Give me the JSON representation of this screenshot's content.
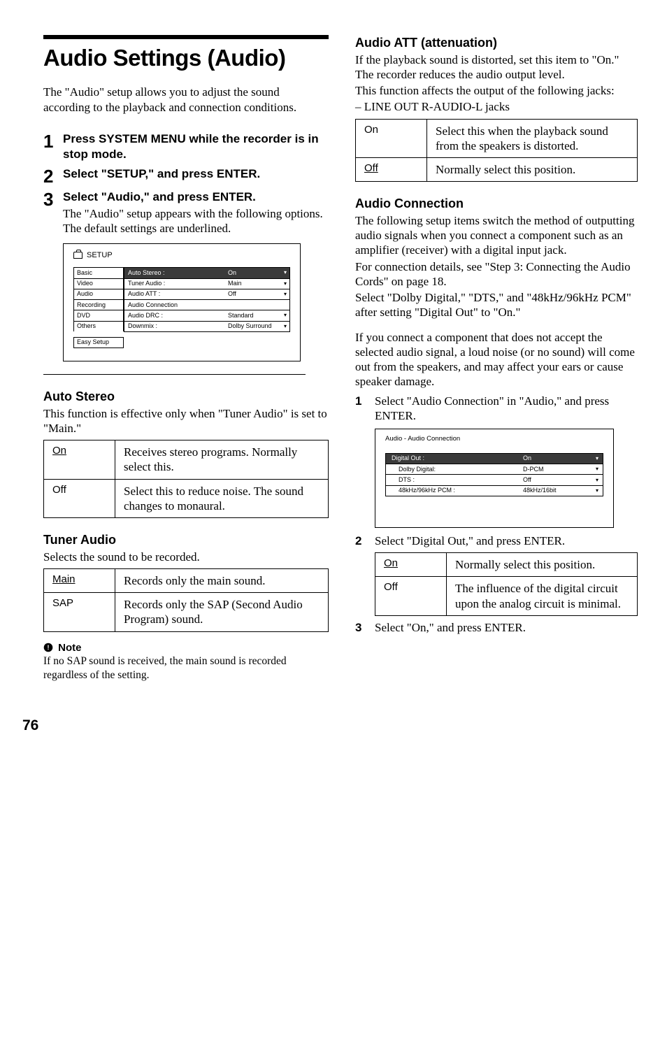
{
  "page_number": "76",
  "title": "Audio Settings (Audio)",
  "intro": "The \"Audio\" setup allows you to adjust the sound according to the playback and connection conditions.",
  "steps": [
    {
      "num": "1",
      "head": "Press SYSTEM MENU while the recorder is in stop mode."
    },
    {
      "num": "2",
      "head": "Select \"SETUP,\" and press ENTER."
    },
    {
      "num": "3",
      "head": "Select \"Audio,\" and press ENTER.",
      "text": "The \"Audio\" setup appears with the following options. The default settings are underlined."
    }
  ],
  "setup_ui": {
    "title": "SETUP",
    "cats": [
      "Basic",
      "Video",
      "Audio",
      "Recording",
      "DVD",
      "Others"
    ],
    "easy": "Easy Setup",
    "rows": [
      {
        "label": "Auto Stereo :",
        "val": "On",
        "sel": true
      },
      {
        "label": "Tuner Audio :",
        "val": "Main"
      },
      {
        "label": "Audio ATT :",
        "val": "Off"
      },
      {
        "label": "Audio Connection",
        "val": ""
      },
      {
        "label": "Audio DRC :",
        "val": "Standard"
      },
      {
        "label": "Downmix :",
        "val": "Dolby Surround"
      }
    ]
  },
  "auto_stereo": {
    "head": "Auto Stereo",
    "para": "This function is effective only when \"Tuner Audio\" is set to \"Main.\"",
    "opts": [
      {
        "k": "On",
        "u": true,
        "v": "Receives stereo programs. Normally select this."
      },
      {
        "k": "Off",
        "v": "Select this to reduce noise. The sound changes to monaural."
      }
    ]
  },
  "tuner_audio": {
    "head": "Tuner Audio",
    "para": "Selects the sound to be recorded.",
    "opts": [
      {
        "k": "Main",
        "u": true,
        "v": "Records only the main sound."
      },
      {
        "k": "SAP",
        "v": "Records only the SAP (Second Audio Program) sound."
      }
    ]
  },
  "note": {
    "head": "Note",
    "text": "If no SAP sound is received, the main sound is recorded regardless of the setting."
  },
  "audio_att": {
    "head": "Audio ATT (attenuation)",
    "p1": "If the playback sound is distorted, set this item to \"On.\" The recorder reduces the audio output level.",
    "p2": "This function affects the output of the following jacks:",
    "p3": "– LINE OUT R-AUDIO-L jacks",
    "opts": [
      {
        "k": "On",
        "v": "Select this when the playback sound from the speakers is distorted."
      },
      {
        "k": "Off",
        "u": true,
        "v": "Normally select this position."
      }
    ]
  },
  "audio_conn": {
    "head": "Audio Connection",
    "p1": "The following setup items switch the method of outputting audio signals when you connect a component such as an amplifier (receiver) with a digital input jack.",
    "p2": "For connection details, see \"Step 3: Connecting the Audio Cords\" on page 18.",
    "p3": "Select \"Dolby Digital,\" \"DTS,\" and \"48kHz/96kHz PCM\" after setting \"Digital Out\" to \"On.\"",
    "p4": "If you connect a component that does not accept the selected audio signal, a loud noise (or no sound) will come out from the speakers, and may affect your ears or cause speaker damage.",
    "sub1": {
      "n": "1",
      "t": "Select \"Audio Connection\" in \"Audio,\" and press ENTER."
    },
    "ui": {
      "title": "Audio - Audio Connection",
      "rows": [
        {
          "l": "Digital Out :",
          "r": "On",
          "sel": true
        },
        {
          "l": "Dolby Digital:",
          "r": "D-PCM",
          "indent": true
        },
        {
          "l": "DTS :",
          "r": "Off",
          "indent": true
        },
        {
          "l": "48kHz/96kHz PCM :",
          "r": "48kHz/16bit",
          "indent": true
        }
      ]
    },
    "sub2": {
      "n": "2",
      "t": "Select \"Digital Out,\" and press ENTER."
    },
    "opts2": [
      {
        "k": "On",
        "u": true,
        "v": "Normally select this position."
      },
      {
        "k": "Off",
        "v": "The influence of the digital circuit upon the analog circuit is minimal."
      }
    ],
    "sub3": {
      "n": "3",
      "t": "Select \"On,\" and press ENTER."
    }
  }
}
